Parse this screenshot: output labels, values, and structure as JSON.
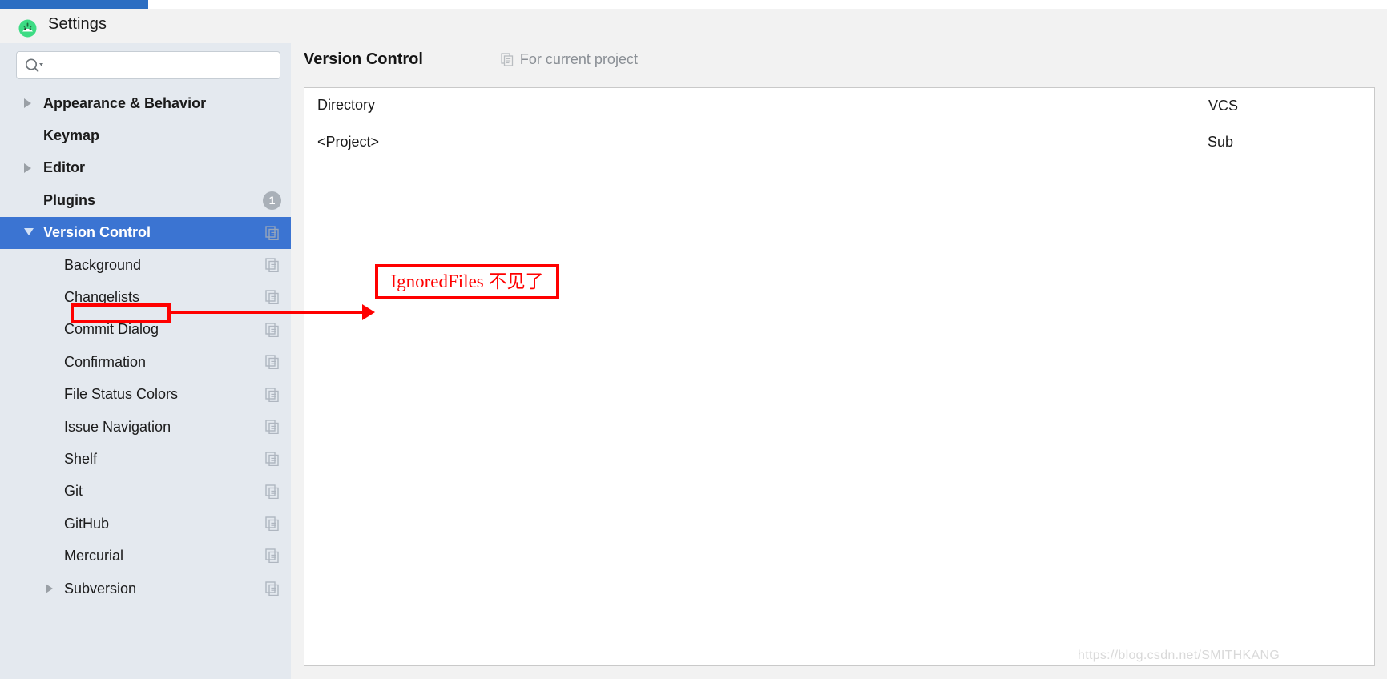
{
  "window": {
    "title": "Settings",
    "app_icon": "android-studio-icon"
  },
  "search": {
    "value": "",
    "placeholder": "",
    "icon": "search-icon"
  },
  "sidebar": {
    "items": [
      {
        "label": "Appearance & Behavior",
        "level": 0,
        "arrow": "right",
        "bold": true,
        "selected": false,
        "copy_icon": false,
        "badge": ""
      },
      {
        "label": "Keymap",
        "level": 0,
        "arrow": "none",
        "bold": true,
        "selected": false,
        "copy_icon": false,
        "badge": ""
      },
      {
        "label": "Editor",
        "level": 0,
        "arrow": "right",
        "bold": true,
        "selected": false,
        "copy_icon": false,
        "badge": ""
      },
      {
        "label": "Plugins",
        "level": 0,
        "arrow": "none",
        "bold": true,
        "selected": false,
        "copy_icon": false,
        "badge": "1"
      },
      {
        "label": "Version Control",
        "level": 0,
        "arrow": "down",
        "bold": true,
        "selected": true,
        "copy_icon": true,
        "badge": ""
      },
      {
        "label": "Background",
        "level": 1,
        "arrow": "none",
        "bold": false,
        "selected": false,
        "copy_icon": true,
        "badge": ""
      },
      {
        "label": "Changelists",
        "level": 1,
        "arrow": "none",
        "bold": false,
        "selected": false,
        "copy_icon": true,
        "badge": ""
      },
      {
        "label": "Commit Dialog",
        "level": 1,
        "arrow": "none",
        "bold": false,
        "selected": false,
        "copy_icon": true,
        "badge": ""
      },
      {
        "label": "Confirmation",
        "level": 1,
        "arrow": "none",
        "bold": false,
        "selected": false,
        "copy_icon": true,
        "badge": ""
      },
      {
        "label": "File Status Colors",
        "level": 1,
        "arrow": "none",
        "bold": false,
        "selected": false,
        "copy_icon": true,
        "badge": ""
      },
      {
        "label": "Issue Navigation",
        "level": 1,
        "arrow": "none",
        "bold": false,
        "selected": false,
        "copy_icon": true,
        "badge": ""
      },
      {
        "label": "Shelf",
        "level": 1,
        "arrow": "none",
        "bold": false,
        "selected": false,
        "copy_icon": true,
        "badge": ""
      },
      {
        "label": "Git",
        "level": 1,
        "arrow": "none",
        "bold": false,
        "selected": false,
        "copy_icon": true,
        "badge": ""
      },
      {
        "label": "GitHub",
        "level": 1,
        "arrow": "none",
        "bold": false,
        "selected": false,
        "copy_icon": true,
        "badge": ""
      },
      {
        "label": "Mercurial",
        "level": 1,
        "arrow": "none",
        "bold": false,
        "selected": false,
        "copy_icon": true,
        "badge": ""
      },
      {
        "label": "Subversion",
        "level": 1,
        "arrow": "right",
        "bold": false,
        "selected": false,
        "copy_icon": true,
        "badge": ""
      }
    ]
  },
  "main": {
    "title": "Version Control",
    "scope_label": "For current project",
    "scope_icon": "copy-icon",
    "table": {
      "columns": [
        "Directory",
        "VCS"
      ],
      "rows": [
        {
          "directory": "<Project>",
          "vcs": "Sub"
        }
      ]
    }
  },
  "annotation": {
    "text": "IgnoredFiles 不见了",
    "color": "#ff0000"
  },
  "watermark": {
    "text": "https://blog.csdn.net/SMITHKANG"
  },
  "colors": {
    "selection": "#3b74d2",
    "sidebar_bg": "#e4e9ef",
    "panel_bg": "#f2f2f2",
    "annotation_red": "#ff0000",
    "badge_gray": "#a9b0b8"
  }
}
